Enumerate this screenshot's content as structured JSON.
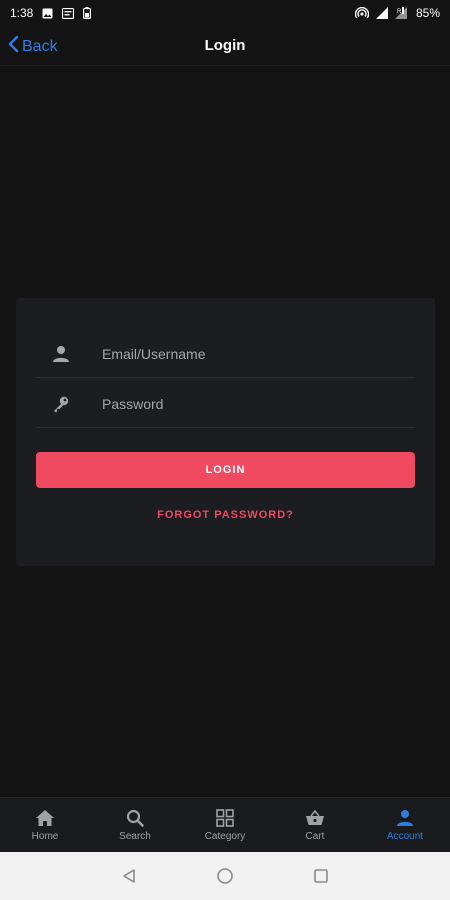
{
  "status_bar": {
    "time": "1:38",
    "battery": "85%",
    "icons": [
      "image-icon",
      "message-icon",
      "battery-saver-icon",
      "hotspot-icon",
      "signal-icon",
      "signal-off-icon"
    ]
  },
  "app_bar": {
    "back_label": "Back",
    "title": "Login"
  },
  "form": {
    "email_placeholder": "Email/Username",
    "password_placeholder": "Password",
    "login_label": "LOGIN",
    "forgot_label": "FORGOT PASSWORD?"
  },
  "bottom_nav": {
    "items": [
      {
        "label": "Home",
        "icon": "home-icon"
      },
      {
        "label": "Search",
        "icon": "search-icon"
      },
      {
        "label": "Category",
        "icon": "grid-icon"
      },
      {
        "label": "Cart",
        "icon": "basket-icon"
      },
      {
        "label": "Account",
        "icon": "person-icon",
        "active": true
      }
    ]
  },
  "colors": {
    "background": "#131314",
    "card": "#1c1d20",
    "accent": "#ef4a5f",
    "link": "#2f7de1",
    "nav_inactive": "#a0a1a5"
  }
}
